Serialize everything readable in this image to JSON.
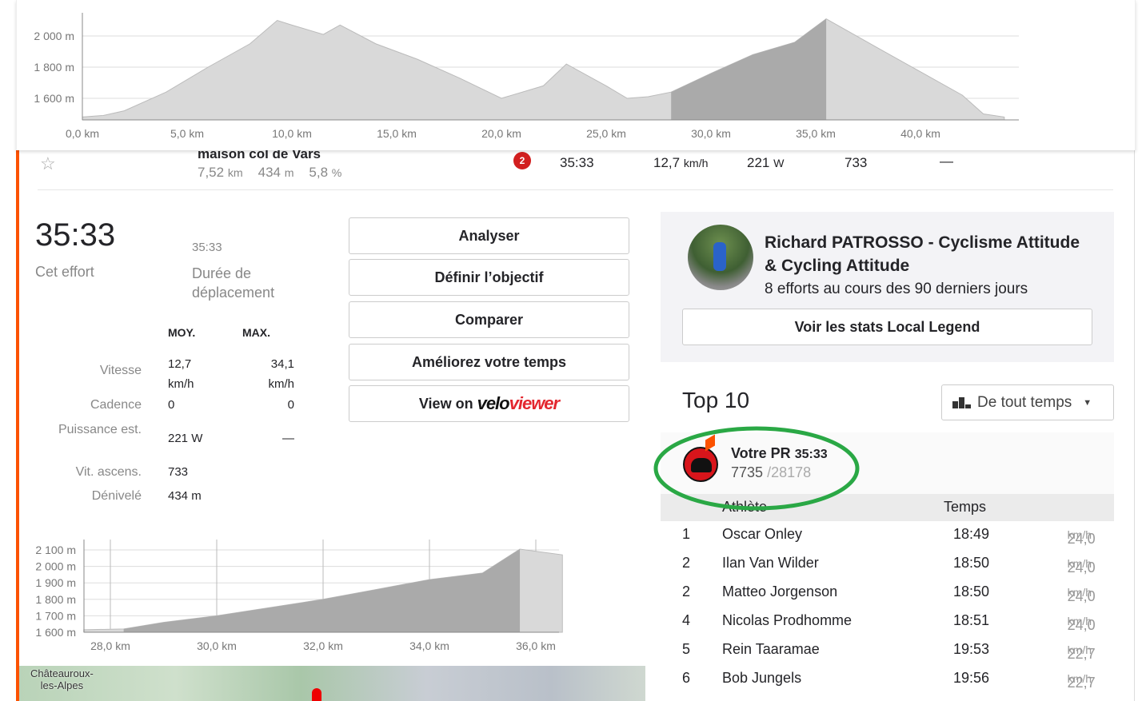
{
  "top_chart": {
    "y_ticks": [
      "2 000 m",
      "1 800 m",
      "1 600 m"
    ],
    "y_values": [
      2000,
      1800,
      1600
    ],
    "x_ticks": [
      "0,0 km",
      "5,0 km",
      "10,0 km",
      "15,0 km",
      "20,0 km",
      "25,0 km",
      "30,0 km",
      "35,0 km",
      "40,0 km"
    ],
    "x_values": [
      0,
      5,
      10,
      15,
      20,
      25,
      30,
      35,
      40
    ],
    "profile": [
      [
        0,
        1480
      ],
      [
        1,
        1490
      ],
      [
        2,
        1520
      ],
      [
        4,
        1640
      ],
      [
        6,
        1800
      ],
      [
        8,
        1950
      ],
      [
        9.3,
        2100
      ],
      [
        10,
        2070
      ],
      [
        11.5,
        2010
      ],
      [
        12.3,
        2070
      ],
      [
        14,
        1950
      ],
      [
        16,
        1850
      ],
      [
        18,
        1730
      ],
      [
        20,
        1600
      ],
      [
        22,
        1680
      ],
      [
        23.1,
        1820
      ],
      [
        25,
        1680
      ],
      [
        26,
        1600
      ],
      [
        27,
        1610
      ],
      [
        28.1,
        1640
      ],
      [
        30,
        1760
      ],
      [
        32,
        1880
      ],
      [
        34,
        1960
      ],
      [
        35.5,
        2110
      ],
      [
        38,
        1920
      ],
      [
        40,
        1770
      ],
      [
        42,
        1620
      ],
      [
        43,
        1500
      ],
      [
        44,
        1480
      ]
    ],
    "highlight": [
      28.1,
      35.5
    ]
  },
  "segment": {
    "name": "maison col de Vars",
    "distance": "7,52",
    "distance_unit": "km",
    "elev": "434",
    "elev_unit": "m",
    "grade": "5,8",
    "grade_unit": "%",
    "rank_badge": "2",
    "time": "35:33",
    "speed": "12,7",
    "speed_unit": "km/h",
    "power": "221",
    "power_unit": "W",
    "vam": "733",
    "hr": "—"
  },
  "effort": {
    "time": "35:33",
    "time_label": "Cet effort",
    "moving_time": "35:33",
    "moving_label": "Durée de déplacement"
  },
  "stats": {
    "avg_header": "MOY.",
    "max_header": "MAX.",
    "rows": [
      {
        "label": "Vitesse",
        "avg": "12,7 km/h",
        "max": "34,1 km/h"
      },
      {
        "label": "Cadence",
        "avg": "0",
        "max": "0"
      },
      {
        "label": "Puissance est.",
        "avg": "221 W",
        "max": "—"
      },
      {
        "label": "Vit. ascens.",
        "avg": "733",
        "max": ""
      },
      {
        "label": "Dénivelé",
        "avg": "434 m",
        "max": ""
      }
    ]
  },
  "buttons": {
    "analyze": "Analyser",
    "goal": "Définir l’objectif",
    "compare": "Comparer",
    "improve": "Améliorez votre temps",
    "view_on": "View on",
    "veloviewer_a": "velo",
    "veloviewer_b": "viewer"
  },
  "small_chart": {
    "y_ticks": [
      "2 100 m",
      "2 000 m",
      "1 900 m",
      "1 800 m",
      "1 700 m",
      "1 600 m"
    ],
    "y_values": [
      2100,
      2000,
      1900,
      1800,
      1700,
      1600
    ],
    "x_ticks": [
      "28,0 km",
      "30,0 km",
      "32,0 km",
      "34,0 km",
      "36,0 km"
    ],
    "x_values": [
      28,
      30,
      32,
      34,
      36
    ],
    "profile": [
      [
        27.5,
        1615
      ],
      [
        28.25,
        1620
      ],
      [
        29,
        1660
      ],
      [
        30,
        1700
      ],
      [
        31,
        1750
      ],
      [
        32,
        1800
      ],
      [
        33,
        1860
      ],
      [
        34,
        1920
      ],
      [
        35,
        1960
      ],
      [
        35.7,
        2105
      ],
      [
        36.5,
        2070
      ]
    ],
    "highlight": [
      28.25,
      35.7
    ]
  },
  "map": {
    "place": "Châteauroux-les-Alpes",
    "place_1": "Châteauroux-",
    "place_2": "les-Alpes"
  },
  "legend": {
    "name": "Richard PATROSSO - Cyclisme Attitude & Cycling Attitude",
    "efforts": "8 efforts au cours des 90 derniers jours",
    "button": "Voir les stats Local Legend"
  },
  "leaderboard": {
    "title": "Top 10",
    "filter": "De tout temps",
    "pr_label": "Votre PR",
    "pr_time": "35:33",
    "pr_rank": "7735",
    "pr_total": "/28178",
    "col_athlete": "Athlète",
    "col_time": "Temps",
    "unit": "km/h",
    "rows": [
      {
        "rank": "1",
        "name": "Oscar Onley",
        "time": "18:49",
        "speed": "24,0"
      },
      {
        "rank": "2",
        "name": "Ilan Van Wilder",
        "time": "18:50",
        "speed": "24,0"
      },
      {
        "rank": "2",
        "name": "Matteo Jorgenson",
        "time": "18:50",
        "speed": "24,0"
      },
      {
        "rank": "4",
        "name": "Nicolas Prodhomme",
        "time": "18:51",
        "speed": "24,0"
      },
      {
        "rank": "5",
        "name": "Rein Taaramae",
        "time": "19:53",
        "speed": "22,7"
      },
      {
        "rank": "6",
        "name": "Bob Jungels",
        "time": "19:56",
        "speed": "22,7"
      }
    ]
  },
  "colors": {
    "accent": "#fc5200",
    "annotation": "#2aa845"
  }
}
